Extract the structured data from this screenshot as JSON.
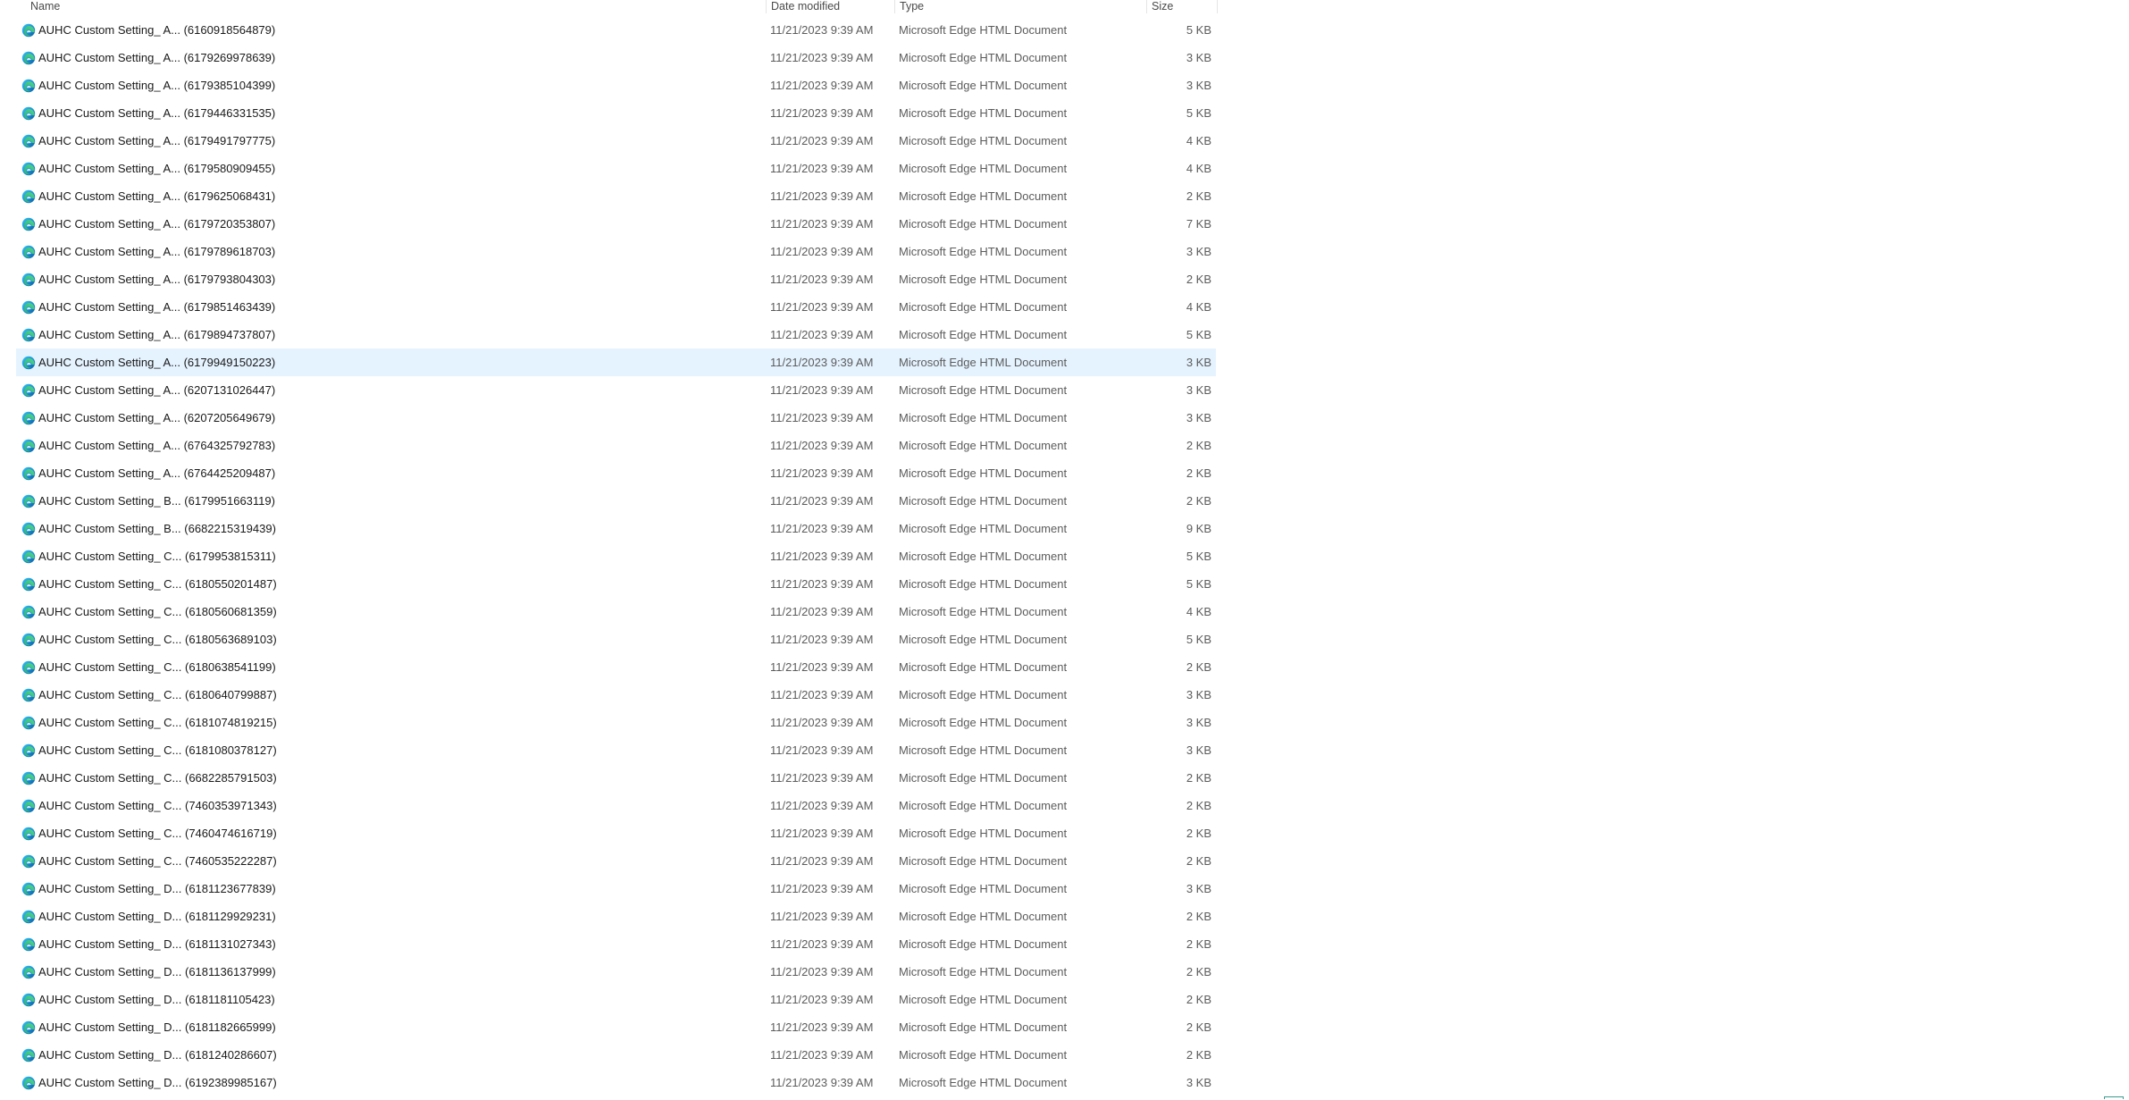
{
  "columns": {
    "name": "Name",
    "date": "Date modified",
    "type": "Type",
    "size": "Size"
  },
  "icon": "microsoft-edge-icon",
  "colors": {
    "selected_row": "#e5f3ff",
    "header_text": "#4a4a4a",
    "secondary_text": "#5c5c5c"
  },
  "rows": [
    {
      "name": "AUHC Custom Setting_ A... (6160918564879)",
      "date": "11/21/2023 9:39 AM",
      "type": "Microsoft Edge HTML Document",
      "size": "5 KB"
    },
    {
      "name": "AUHC Custom Setting_ A... (6179269978639)",
      "date": "11/21/2023 9:39 AM",
      "type": "Microsoft Edge HTML Document",
      "size": "3 KB"
    },
    {
      "name": "AUHC Custom Setting_ A... (6179385104399)",
      "date": "11/21/2023 9:39 AM",
      "type": "Microsoft Edge HTML Document",
      "size": "3 KB"
    },
    {
      "name": "AUHC Custom Setting_ A... (6179446331535)",
      "date": "11/21/2023 9:39 AM",
      "type": "Microsoft Edge HTML Document",
      "size": "5 KB"
    },
    {
      "name": "AUHC Custom Setting_ A... (6179491797775)",
      "date": "11/21/2023 9:39 AM",
      "type": "Microsoft Edge HTML Document",
      "size": "4 KB"
    },
    {
      "name": "AUHC Custom Setting_ A... (6179580909455)",
      "date": "11/21/2023 9:39 AM",
      "type": "Microsoft Edge HTML Document",
      "size": "4 KB"
    },
    {
      "name": "AUHC Custom Setting_ A... (6179625068431)",
      "date": "11/21/2023 9:39 AM",
      "type": "Microsoft Edge HTML Document",
      "size": "2 KB"
    },
    {
      "name": "AUHC Custom Setting_ A... (6179720353807)",
      "date": "11/21/2023 9:39 AM",
      "type": "Microsoft Edge HTML Document",
      "size": "7 KB"
    },
    {
      "name": "AUHC Custom Setting_ A... (6179789618703)",
      "date": "11/21/2023 9:39 AM",
      "type": "Microsoft Edge HTML Document",
      "size": "3 KB"
    },
    {
      "name": "AUHC Custom Setting_ A... (6179793804303)",
      "date": "11/21/2023 9:39 AM",
      "type": "Microsoft Edge HTML Document",
      "size": "2 KB"
    },
    {
      "name": "AUHC Custom Setting_ A... (6179851463439)",
      "date": "11/21/2023 9:39 AM",
      "type": "Microsoft Edge HTML Document",
      "size": "4 KB"
    },
    {
      "name": "AUHC Custom Setting_ A... (6179894737807)",
      "date": "11/21/2023 9:39 AM",
      "type": "Microsoft Edge HTML Document",
      "size": "5 KB"
    },
    {
      "name": "AUHC Custom Setting_ A... (6179949150223)",
      "date": "11/21/2023 9:39 AM",
      "type": "Microsoft Edge HTML Document",
      "size": "3 KB",
      "selected": true
    },
    {
      "name": "AUHC Custom Setting_ A... (6207131026447)",
      "date": "11/21/2023 9:39 AM",
      "type": "Microsoft Edge HTML Document",
      "size": "3 KB"
    },
    {
      "name": "AUHC Custom Setting_ A... (6207205649679)",
      "date": "11/21/2023 9:39 AM",
      "type": "Microsoft Edge HTML Document",
      "size": "3 KB"
    },
    {
      "name": "AUHC Custom Setting_ A... (6764325792783)",
      "date": "11/21/2023 9:39 AM",
      "type": "Microsoft Edge HTML Document",
      "size": "2 KB"
    },
    {
      "name": "AUHC Custom Setting_ A... (6764425209487)",
      "date": "11/21/2023 9:39 AM",
      "type": "Microsoft Edge HTML Document",
      "size": "2 KB"
    },
    {
      "name": "AUHC Custom Setting_ B... (6179951663119)",
      "date": "11/21/2023 9:39 AM",
      "type": "Microsoft Edge HTML Document",
      "size": "2 KB"
    },
    {
      "name": "AUHC Custom Setting_ B... (6682215319439)",
      "date": "11/21/2023 9:39 AM",
      "type": "Microsoft Edge HTML Document",
      "size": "9 KB"
    },
    {
      "name": "AUHC Custom Setting_ C... (6179953815311)",
      "date": "11/21/2023 9:39 AM",
      "type": "Microsoft Edge HTML Document",
      "size": "5 KB"
    },
    {
      "name": "AUHC Custom Setting_ C... (6180550201487)",
      "date": "11/21/2023 9:39 AM",
      "type": "Microsoft Edge HTML Document",
      "size": "5 KB"
    },
    {
      "name": "AUHC Custom Setting_ C... (6180560681359)",
      "date": "11/21/2023 9:39 AM",
      "type": "Microsoft Edge HTML Document",
      "size": "4 KB"
    },
    {
      "name": "AUHC Custom Setting_ C... (6180563689103)",
      "date": "11/21/2023 9:39 AM",
      "type": "Microsoft Edge HTML Document",
      "size": "5 KB"
    },
    {
      "name": "AUHC Custom Setting_ C... (6180638541199)",
      "date": "11/21/2023 9:39 AM",
      "type": "Microsoft Edge HTML Document",
      "size": "2 KB"
    },
    {
      "name": "AUHC Custom Setting_ C... (6180640799887)",
      "date": "11/21/2023 9:39 AM",
      "type": "Microsoft Edge HTML Document",
      "size": "3 KB"
    },
    {
      "name": "AUHC Custom Setting_ C... (6181074819215)",
      "date": "11/21/2023 9:39 AM",
      "type": "Microsoft Edge HTML Document",
      "size": "3 KB"
    },
    {
      "name": "AUHC Custom Setting_ C... (6181080378127)",
      "date": "11/21/2023 9:39 AM",
      "type": "Microsoft Edge HTML Document",
      "size": "3 KB"
    },
    {
      "name": "AUHC Custom Setting_ C... (6682285791503)",
      "date": "11/21/2023 9:39 AM",
      "type": "Microsoft Edge HTML Document",
      "size": "2 KB"
    },
    {
      "name": "AUHC Custom Setting_ C... (7460353971343)",
      "date": "11/21/2023 9:39 AM",
      "type": "Microsoft Edge HTML Document",
      "size": "2 KB"
    },
    {
      "name": "AUHC Custom Setting_ C... (7460474616719)",
      "date": "11/21/2023 9:39 AM",
      "type": "Microsoft Edge HTML Document",
      "size": "2 KB"
    },
    {
      "name": "AUHC Custom Setting_ C... (7460535222287)",
      "date": "11/21/2023 9:39 AM",
      "type": "Microsoft Edge HTML Document",
      "size": "2 KB"
    },
    {
      "name": "AUHC Custom Setting_ D... (6181123677839)",
      "date": "11/21/2023 9:39 AM",
      "type": "Microsoft Edge HTML Document",
      "size": "3 KB"
    },
    {
      "name": "AUHC Custom Setting_ D... (6181129929231)",
      "date": "11/21/2023 9:39 AM",
      "type": "Microsoft Edge HTML Document",
      "size": "2 KB"
    },
    {
      "name": "AUHC Custom Setting_ D... (6181131027343)",
      "date": "11/21/2023 9:39 AM",
      "type": "Microsoft Edge HTML Document",
      "size": "2 KB"
    },
    {
      "name": "AUHC Custom Setting_ D... (6181136137999)",
      "date": "11/21/2023 9:39 AM",
      "type": "Microsoft Edge HTML Document",
      "size": "2 KB"
    },
    {
      "name": "AUHC Custom Setting_ D... (6181181105423)",
      "date": "11/21/2023 9:39 AM",
      "type": "Microsoft Edge HTML Document",
      "size": "2 KB"
    },
    {
      "name": "AUHC Custom Setting_ D... (6181182665999)",
      "date": "11/21/2023 9:39 AM",
      "type": "Microsoft Edge HTML Document",
      "size": "2 KB"
    },
    {
      "name": "AUHC Custom Setting_ D... (6181240286607)",
      "date": "11/21/2023 9:39 AM",
      "type": "Microsoft Edge HTML Document",
      "size": "2 KB"
    },
    {
      "name": "AUHC Custom Setting_ D... (6192389985167)",
      "date": "11/21/2023 9:39 AM",
      "type": "Microsoft Edge HTML Document",
      "size": "3 KB"
    }
  ]
}
